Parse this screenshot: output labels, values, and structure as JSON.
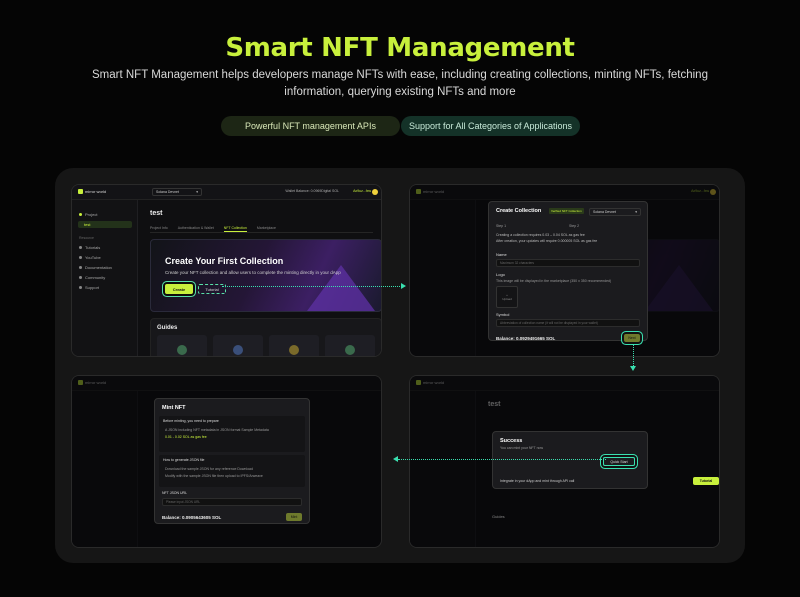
{
  "hero": {
    "title": "Smart NFT Management",
    "description": "Smart NFT Management helps developers manage NFTs with ease, including creating collections, minting NFTs, fetching information, querying existing NFTs and more",
    "pills": [
      "Powerful NFT management APIs",
      "Support for All Categories of Applications"
    ]
  },
  "colors": {
    "accent": "#c8f03c",
    "arrow": "#3ae0b0",
    "background": "#050505"
  },
  "app": {
    "logo": "mirror world",
    "network": "Solana Devnet",
    "wallet_label": "Wallet Balance: 0.0969Digital SOL",
    "wallet_badge": "DEVNET",
    "address": "Ax9uz...fxw",
    "sidebar": {
      "project": "Project",
      "project_item": "test",
      "resources": "Resource",
      "items": [
        "Tutorials",
        "YouTube",
        "Documentation",
        "Community",
        "Support"
      ]
    },
    "project_title": "test",
    "tabs": [
      "Project Info",
      "Authentication & Wallet",
      "NFT Collection",
      "Marketplace"
    ],
    "banner": {
      "title": "Create Your First Collection",
      "text": "Create your NFT collection and allow users to complete the minting directly in your dApp",
      "create": "Create",
      "tutorial": "Tutorial"
    },
    "guides": "Guides"
  },
  "create_modal": {
    "title": "Create Collection",
    "tab_a": "Verified NFT Collection",
    "network": "Solana Devnet",
    "step1": "Step 1",
    "step2": "Step 2",
    "notes": [
      "Creating a collection requires 0.03 – 0.04 SOL as gas fee",
      "After creation, your updates will require 0.000005 SOL as gas fee"
    ],
    "name_label": "Name",
    "name_placeholder": "Maximum 32 characters",
    "logo_label": "Logo",
    "logo_hint": "This image will be displayed in the marketplace (350 x 350 recommended)",
    "upload": "Upload",
    "symbol_label": "Symbol",
    "symbol_placeholder": "Abbreviation of collection name (it will not be displayed in your wallet)",
    "balance": "Balance: 0.0929491665 SOL",
    "next": "Next"
  },
  "mint_modal": {
    "title": "Mint NFT",
    "prep": "Before minting, you need to prepare",
    "items": [
      "A JSON including NFT metadata in JSON format Sample Metadata",
      "0.01 - 0.02 SOL as gas fee"
    ],
    "how": "How to generate JSON file",
    "steps": [
      "Download the sample JSON for any reference Download",
      "Modify with the sample JSON file then upload to IPFS/Arweave"
    ],
    "json_label": "NFT JSON URL",
    "json_placeholder": "Please input JSON URL",
    "balance": "Balance: 0.0905643605 SOL",
    "mint": "Mint"
  },
  "success_modal": {
    "title": "Success",
    "subtitle": "You can mint your NFT now",
    "quick": "Quick Start",
    "row": "Integrate in your dApp and mint through API call",
    "tutorial": "Tutorial",
    "guides": "Guides",
    "project_title": "test"
  }
}
